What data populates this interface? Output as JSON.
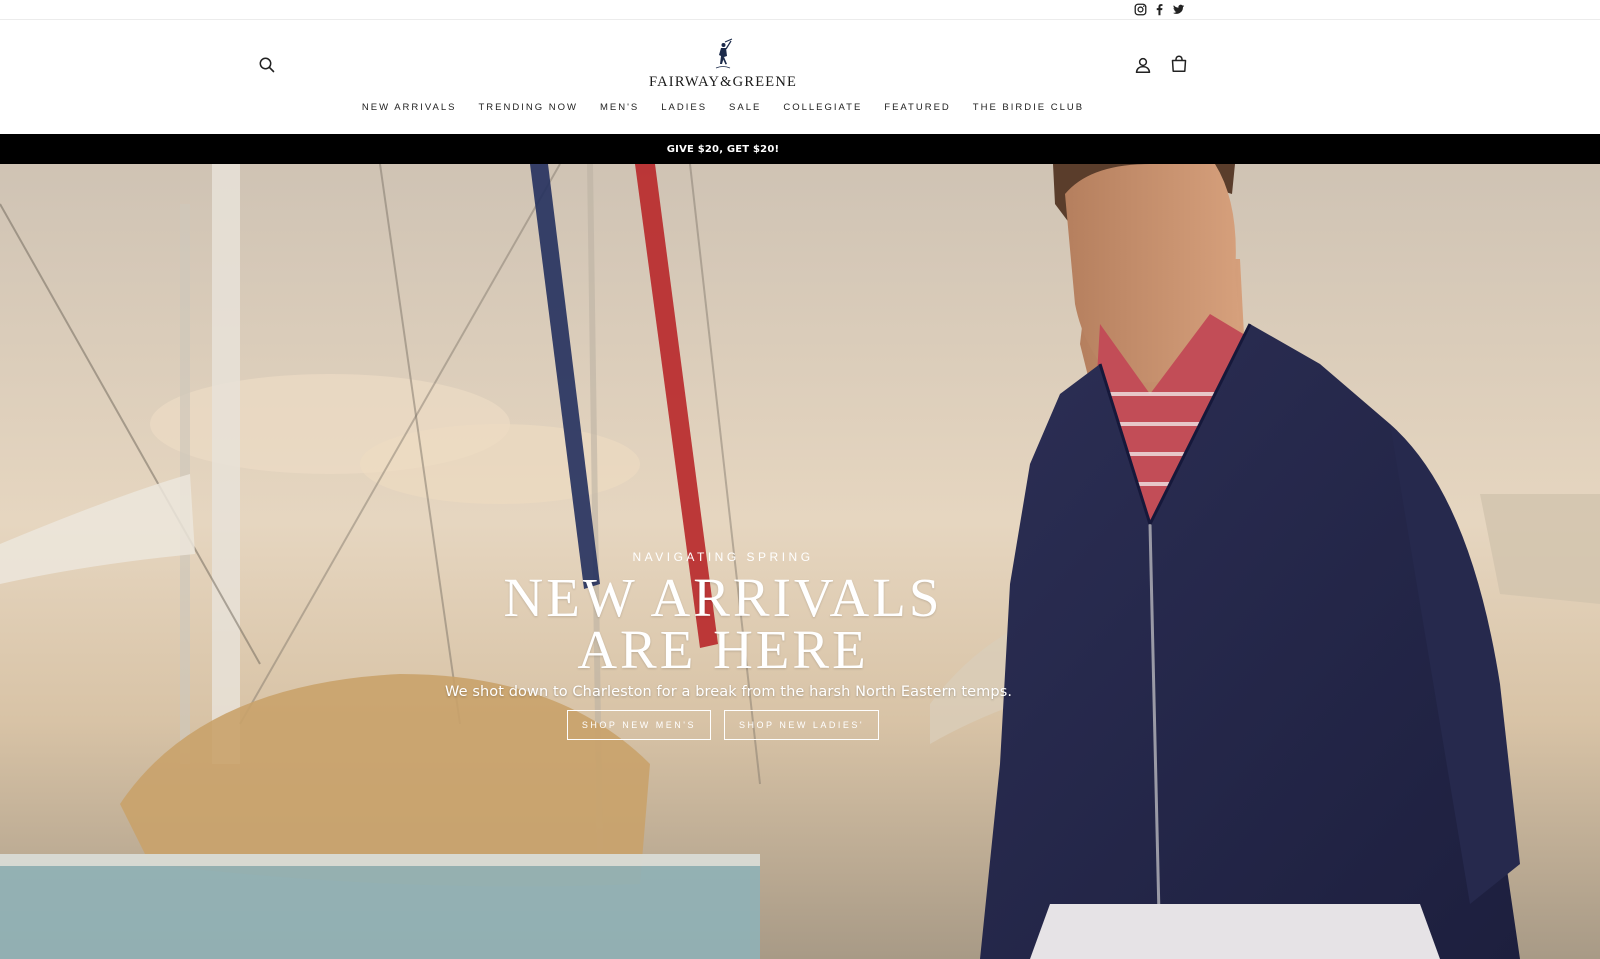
{
  "social": {
    "icons": [
      "instagram-icon",
      "facebook-icon",
      "twitter-icon"
    ]
  },
  "header": {
    "logo_text": "FAIRWAY&GREENE",
    "icons": {
      "search": "search-icon",
      "account": "account-icon",
      "cart": "cart-icon"
    }
  },
  "nav": {
    "items": [
      {
        "label": "NEW ARRIVALS"
      },
      {
        "label": "TRENDING NOW"
      },
      {
        "label": "MEN'S"
      },
      {
        "label": "LADIES"
      },
      {
        "label": "SALE"
      },
      {
        "label": "COLLEGIATE"
      },
      {
        "label": "FEATURED"
      },
      {
        "label": "THE BIRDIE CLUB"
      }
    ]
  },
  "promo": {
    "text": "GIVE $20, GET $20!"
  },
  "hero": {
    "eyebrow": "NAVIGATING SPRING",
    "headline": "NEW ARRIVALS\nARE HERE",
    "subtext": "We shot down to Charleston for a break from the harsh North Eastern temps.",
    "cta_mens": "SHOP NEW MEN'S",
    "cta_ladies": "SHOP NEW LADIES'"
  },
  "colors": {
    "promo_bg": "#000000",
    "text_dark": "#1a1a1a",
    "hero_text": "#ffffff"
  }
}
